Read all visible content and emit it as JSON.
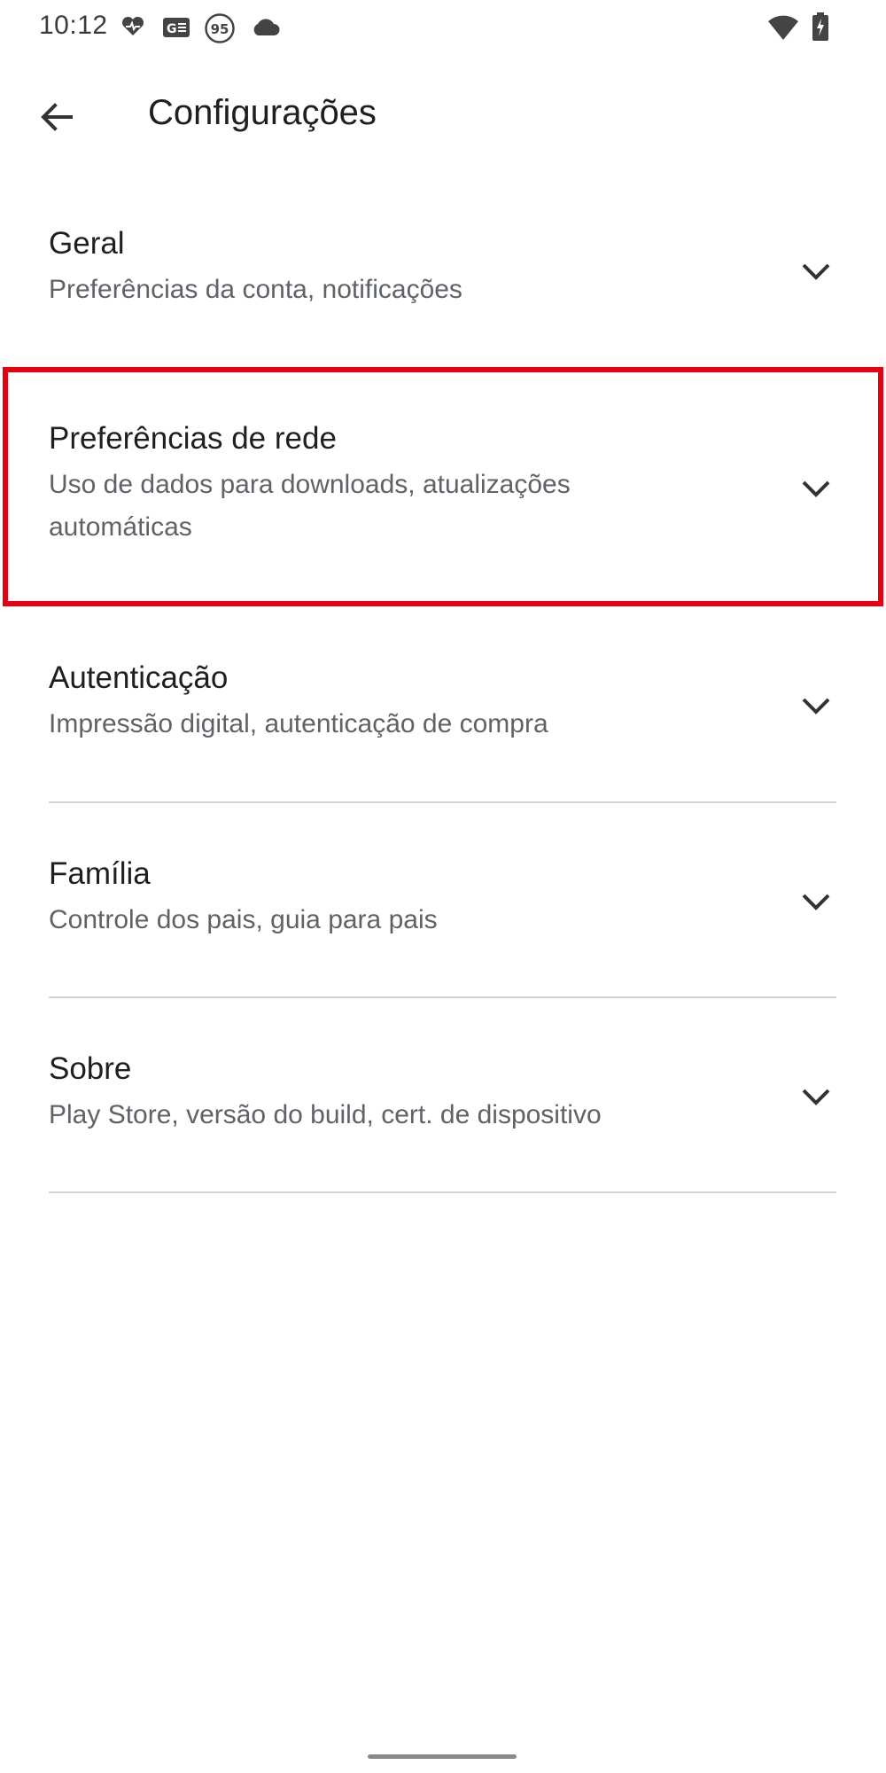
{
  "status_bar": {
    "time": "10:12",
    "icons": [
      "heart-pulse-icon",
      "news-card-icon",
      "circle-95-icon",
      "cloud-icon",
      "wifi-icon",
      "battery-charging-icon"
    ],
    "badge_number": "95"
  },
  "app_bar": {
    "back_icon": "arrow-back-icon",
    "title": "Configurações"
  },
  "settings": [
    {
      "title": "Geral",
      "subtitle": "Preferências da conta, notificações"
    },
    {
      "title": "Preferências de rede",
      "subtitle": "Uso de dados para downloads, atualizações automáticas",
      "highlighted": true
    },
    {
      "title": "Autenticação",
      "subtitle": "Impressão digital, autenticação de compra"
    },
    {
      "title": "Família",
      "subtitle": "Controle dos pais, guia para pais"
    },
    {
      "title": "Sobre",
      "subtitle": "Play Store, versão do build, cert. de dispositivo"
    }
  ],
  "colors": {
    "highlight": "#e60012",
    "title_text": "#1f1f1f",
    "subtitle_text": "#5f6368",
    "divider": "#d5d5d5"
  }
}
